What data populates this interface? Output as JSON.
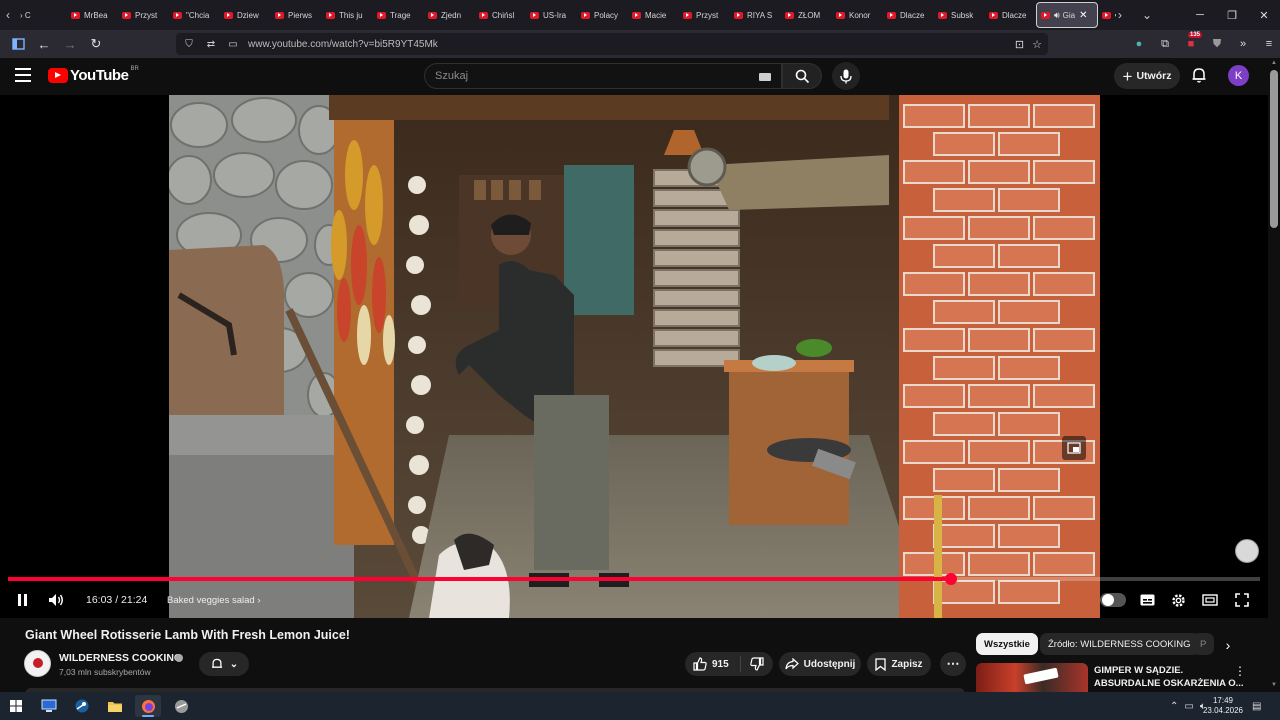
{
  "browser": {
    "tabs": [
      {
        "label": "› C",
        "favicon": "none"
      },
      {
        "label": "MrBea",
        "favicon": "youtube"
      },
      {
        "label": "Przyst",
        "favicon": "youtube"
      },
      {
        "label": "\"Chcia",
        "favicon": "youtube"
      },
      {
        "label": "Dziew",
        "favicon": "youtube"
      },
      {
        "label": "Pierws",
        "favicon": "youtube"
      },
      {
        "label": "This ju",
        "favicon": "youtube"
      },
      {
        "label": "Trage",
        "favicon": "youtube"
      },
      {
        "label": "Zjedn",
        "favicon": "youtube"
      },
      {
        "label": "Chińsl",
        "favicon": "youtube"
      },
      {
        "label": "US-Ira",
        "favicon": "youtube"
      },
      {
        "label": "Polacy",
        "favicon": "youtube"
      },
      {
        "label": "Macie",
        "favicon": "youtube"
      },
      {
        "label": "Przyst",
        "favicon": "youtube"
      },
      {
        "label": "RIYA S",
        "favicon": "youtube"
      },
      {
        "label": "ZŁOM",
        "favicon": "youtube"
      },
      {
        "label": "Konor",
        "favicon": "youtube"
      },
      {
        "label": "Dlacze",
        "favicon": "youtube"
      },
      {
        "label": "Subsk",
        "favicon": "youtube"
      },
      {
        "label": "Dlacze",
        "favicon": "youtube"
      },
      {
        "label": "Gia",
        "favicon": "youtube",
        "active": true
      },
      {
        "label": "Przy",
        "favicon": "youtube",
        "audio": true
      }
    ],
    "url": "www.youtube.com/watch?v=bi5R9YT45Mk",
    "extension_badge": "135"
  },
  "youtube": {
    "logo_text": "YouTube",
    "logo_country": "BR",
    "search_placeholder": "Szukaj",
    "create_label": "Utwórz",
    "avatar_letter": "K"
  },
  "player": {
    "progress_fraction": 0.7533,
    "current_time": "16:03",
    "duration": "21:24",
    "time_display": "16:03 / 21:24",
    "chapter": "Baked veggies salad",
    "quality_badge": "HD"
  },
  "video": {
    "title": "Giant Wheel Rotisserie Lamb With Fresh Lemon Juice!",
    "channel": "WILDERNESS COOKING",
    "subscribers": "7,03 mln subskrybentów",
    "likes": "915",
    "share_label": "Udostępnij",
    "save_label": "Zapisz"
  },
  "sidebar": {
    "chips": [
      "Wszystkie",
      "Źródło: WILDERNESS COOKING",
      "P"
    ],
    "recommendation": {
      "title_line1": "GIMPER W SĄDZIE.",
      "title_line2": "ABSURDALNE OSKARŻENIA O..."
    }
  },
  "taskbar": {
    "time": "17:49",
    "date": "23.04.2026"
  },
  "colors": {
    "youtube_red": "#ff0000",
    "progress_red": "#ff0033",
    "avatar_purple": "#7e3fc7",
    "background": "#0f0f0f"
  }
}
